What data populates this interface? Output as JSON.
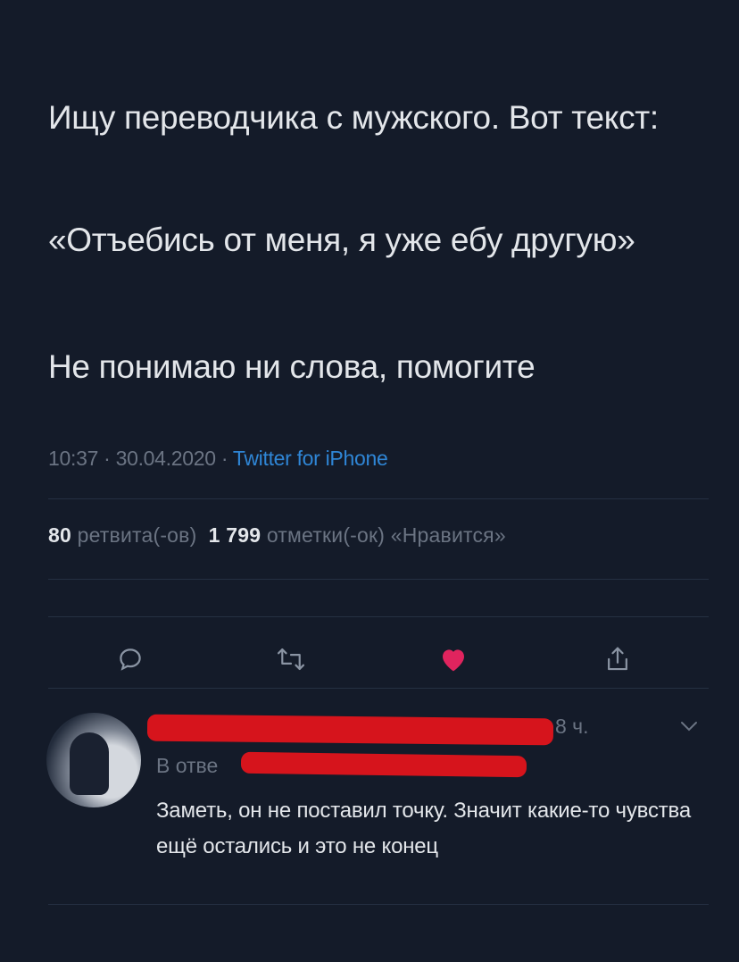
{
  "tweet": {
    "paragraphs": [
      "Ищу переводчика с мужского. Вот текст:",
      "«Отъебись от меня, я уже ебу другую»",
      "Не понимаю ни слова, помогите"
    ],
    "time": "10:37",
    "date": "30.04.2020",
    "source": "Twitter for iPhone",
    "retweets_count": "80",
    "retweets_label": "ретвита(-ов)",
    "likes_count": "1 799",
    "likes_label": "отметки(-ок) «Нравится»"
  },
  "actions": {
    "reply_icon": "comment-icon",
    "retweet_icon": "retweet-icon",
    "like_icon": "heart-icon",
    "share_icon": "share-icon",
    "liked_color": "#e0245e"
  },
  "reply": {
    "time": "8 ч.",
    "reply_to_prefix": "В отве",
    "text": "Заметь, он не поставил точку. Значит какие-то чувства ещё остались и это не конец"
  },
  "colors": {
    "background": "#141b29",
    "link": "#2f86d6",
    "redaction": "#d6141c"
  }
}
